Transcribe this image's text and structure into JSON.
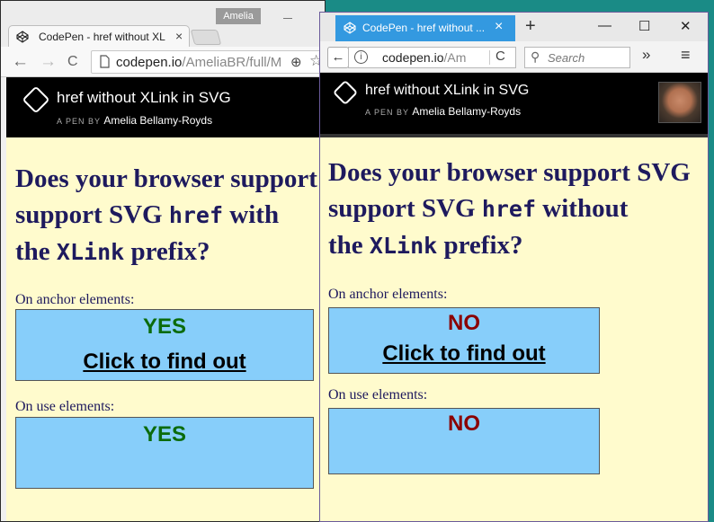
{
  "colors": {
    "desktop": "#1a8b86",
    "content_bg": "#fffbcd",
    "box_bg": "#87cefa",
    "yes": "#0b6b0b",
    "no": "#8b0000",
    "firefox_tab": "#3399e0"
  },
  "left_window": {
    "profile_name": "Amelia",
    "tab_title": "CodePen - href without XL",
    "tab_close": "×",
    "back": "←",
    "forward": "→",
    "reload": "C",
    "url_host": "codepen.io",
    "url_path": "/AmeliaBR/full/M",
    "zoom_icon": "⊕",
    "star_icon": "☆",
    "pen_title": "href without XLink in SVG",
    "by_label": "A PEN BY",
    "author": "Amelia Bellamy-Royds",
    "question": {
      "p1": "Does your browser support SVG ",
      "code1": "href",
      "p2": " with the ",
      "code2": "XLink",
      "p3": " prefix?"
    },
    "anchor_label": "On anchor elements:",
    "anchor_result": "YES",
    "click_text": "Click to find out",
    "use_label": "On use elements:",
    "use_result": "YES"
  },
  "right_window": {
    "tab_title": "CodePen - href without ...",
    "tab_close": "×",
    "new_tab": "+",
    "win_min": "—",
    "win_max": "☐",
    "win_close": "✕",
    "back": "←",
    "info": "i",
    "url_host": "codepen.io",
    "url_path": "/Am",
    "reload": "C",
    "search_placeholder": "Search",
    "more": "»",
    "menu": "≡",
    "pen_title": "href without XLink in SVG",
    "by_label": "A PEN BY",
    "author": "Amelia Bellamy-Royds",
    "question": {
      "p1": "Does your browser support SVG ",
      "code1": "href",
      "p2": " without the ",
      "code2": "XLink",
      "p3": " prefix?"
    },
    "anchor_label": "On anchor elements:",
    "anchor_result": "NO",
    "click_text": "Click to find out",
    "use_label": "On use elements:",
    "use_result": "NO"
  }
}
